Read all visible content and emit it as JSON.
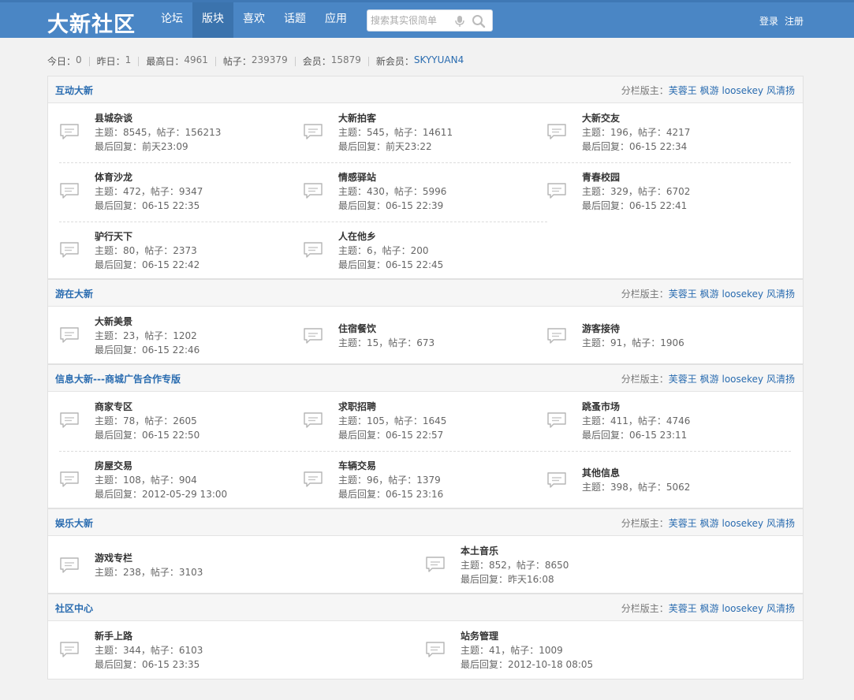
{
  "header": {
    "logo": "大新社区",
    "nav": [
      "论坛",
      "版块",
      "喜欢",
      "话题",
      "应用"
    ],
    "active_nav": "版块",
    "search_placeholder": "搜索其实很简单",
    "login": "登录",
    "register": "注册"
  },
  "stats": {
    "today_label": "今日：",
    "today": "0",
    "yesterday_label": "昨日：",
    "yesterday": "1",
    "max_label": "最高日：",
    "max": "4961",
    "posts_label": "帖子：",
    "posts": "239379",
    "members_label": "会员：",
    "members": "15879",
    "new_label": "新会员：",
    "new_member": "SKYYUAN4"
  },
  "moderators_label": "分栏版主：",
  "moderators": [
    "芙蓉王",
    "枫游",
    "loosekey",
    "风清扬"
  ],
  "topics_label": "主题：",
  "posts_label": "帖子：",
  "last_label": "最后回复：",
  "sections": [
    {
      "title": "互动大新",
      "forums": [
        {
          "name": "县城杂谈",
          "topics": "8545",
          "posts": "156213",
          "last": "前天23:09"
        },
        {
          "name": "大新拍客",
          "topics": "545",
          "posts": "14611",
          "last": "前天23:22"
        },
        {
          "name": "大新交友",
          "topics": "196",
          "posts": "4217",
          "last": "06-15 22:34"
        },
        {
          "name": "体育沙龙",
          "topics": "472",
          "posts": "9347",
          "last": "06-15 22:35"
        },
        {
          "name": "情感驿站",
          "topics": "430",
          "posts": "5996",
          "last": "06-15 22:39"
        },
        {
          "name": "青春校园",
          "topics": "329",
          "posts": "6702",
          "last": "06-15 22:41"
        },
        {
          "name": "驴行天下",
          "topics": "80",
          "posts": "2373",
          "last": "06-15 22:42"
        },
        {
          "name": "人在他乡",
          "topics": "6",
          "posts": "200",
          "last": "06-15 22:45"
        }
      ]
    },
    {
      "title": "游在大新",
      "forums": [
        {
          "name": "大新美景",
          "topics": "23",
          "posts": "1202",
          "last": "06-15 22:46"
        },
        {
          "name": "住宿餐饮",
          "topics": "15",
          "posts": "673",
          "last": ""
        },
        {
          "name": "游客接待",
          "topics": "91",
          "posts": "1906",
          "last": ""
        }
      ]
    },
    {
      "title": "信息大新---商城广告合作专版",
      "forums": [
        {
          "name": "商家专区",
          "topics": "78",
          "posts": "2605",
          "last": "06-15 22:50"
        },
        {
          "name": "求职招聘",
          "topics": "105",
          "posts": "1645",
          "last": "06-15 22:57"
        },
        {
          "name": "跳蚤市场",
          "topics": "411",
          "posts": "4746",
          "last": "06-15 23:11"
        },
        {
          "name": "房屋交易",
          "topics": "108",
          "posts": "904",
          "last": "2012-05-29 13:00"
        },
        {
          "name": "车辆交易",
          "topics": "96",
          "posts": "1379",
          "last": "06-15 23:16"
        },
        {
          "name": "其他信息",
          "topics": "398",
          "posts": "5062",
          "last": ""
        }
      ]
    },
    {
      "title": "娱乐大新",
      "forums": [
        {
          "name": "游戏专栏",
          "topics": "238",
          "posts": "3103",
          "last": ""
        },
        {
          "name": "本土音乐",
          "topics": "852",
          "posts": "8650",
          "last": "昨天16:08"
        }
      ]
    },
    {
      "title": "社区中心",
      "forums": [
        {
          "name": "新手上路",
          "topics": "344",
          "posts": "6103",
          "last": "06-15 23:35"
        },
        {
          "name": "站务管理",
          "topics": "41",
          "posts": "1009",
          "last": "2012-10-18 08:05"
        }
      ]
    }
  ]
}
